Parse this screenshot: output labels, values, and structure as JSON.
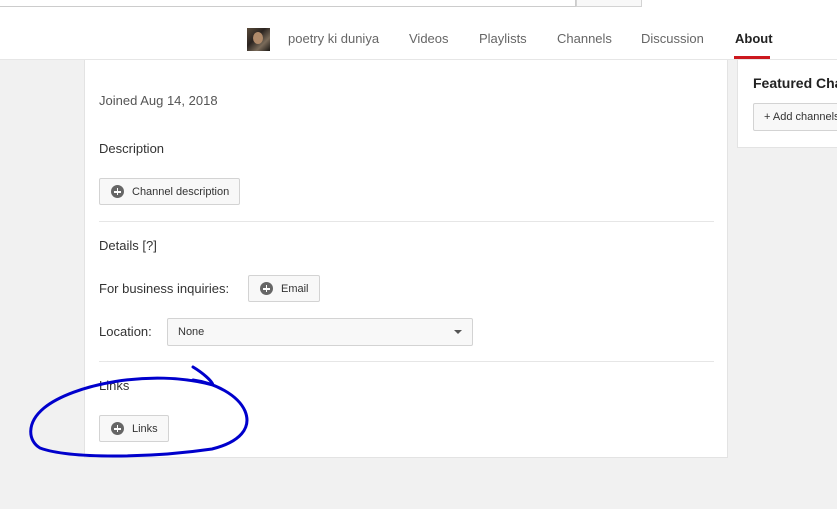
{
  "nav": {
    "channel_name": "poetry ki duniya",
    "tabs": [
      {
        "label": "Videos"
      },
      {
        "label": "Playlists"
      },
      {
        "label": "Channels"
      },
      {
        "label": "Discussion"
      },
      {
        "label": "About"
      }
    ],
    "active_tab": "About"
  },
  "about": {
    "joined": "Joined Aug 14, 2018",
    "description_heading": "Description",
    "description_button": "Channel description",
    "details_heading": "Details [?]",
    "business_label": "For business inquiries:",
    "email_button": "Email",
    "location_label": "Location:",
    "location_value": "None",
    "links_heading": "Links",
    "links_button": "Links"
  },
  "sidebar": {
    "featured_title": "Featured Cha",
    "add_channels_button": "+ Add channels"
  },
  "colors": {
    "active_tab_underline": "#cc181e",
    "annotation_ink": "#0000cc"
  }
}
